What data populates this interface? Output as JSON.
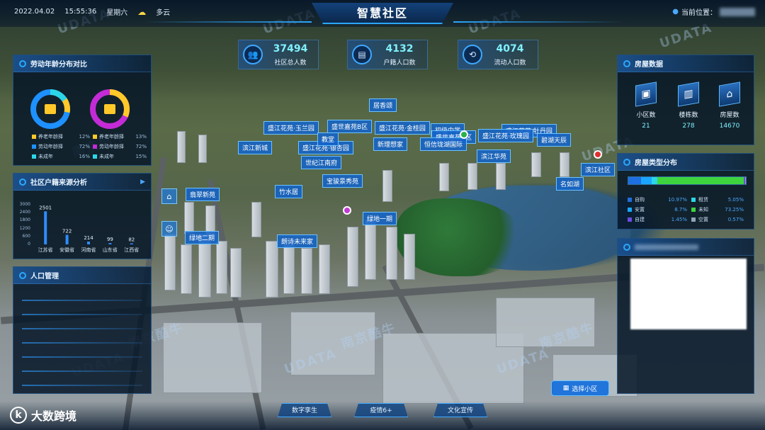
{
  "header": {
    "date": "2022.04.02",
    "time": "15:55:36",
    "weekday": "星期六",
    "weather": "多云",
    "title": "智慧社区",
    "location_label": "当前位置："
  },
  "stats": [
    {
      "value": "37494",
      "label": "社区总人数",
      "icon": "people-icon"
    },
    {
      "value": "4132",
      "label": "户籍人口数",
      "icon": "household-icon"
    },
    {
      "value": "4074",
      "label": "流动人口数",
      "icon": "flow-icon"
    }
  ],
  "age_panel": {
    "title": "劳动年龄分布对比",
    "legend_left": [
      {
        "label": "养老年龄择",
        "pct": "12%",
        "color": "#ffc929"
      },
      {
        "label": "劳动年龄择",
        "pct": "72%",
        "color": "#1e90ff"
      },
      {
        "label": "未成年",
        "pct": "16%",
        "color": "#2cd6e6"
      }
    ],
    "legend_right": [
      {
        "label": "养老年龄择",
        "pct": "13%",
        "color": "#ffc929"
      },
      {
        "label": "劳动年龄择",
        "pct": "72%",
        "color": "#c42bd6"
      },
      {
        "label": "未成年",
        "pct": "15%",
        "color": "#2cd6e6"
      }
    ]
  },
  "chart_data": {
    "type": "bar",
    "title": "社区户籍来源分析",
    "categories": [
      "江苏省",
      "安徽省",
      "河南省",
      "山东省",
      "江西省"
    ],
    "values": [
      2501,
      722,
      214,
      99,
      82
    ],
    "ylim": [
      0,
      3000
    ],
    "yticks": [
      "3000",
      "2400",
      "1800",
      "1200",
      "600",
      "0"
    ],
    "xlabel": "",
    "ylabel": "",
    "color": "#2f8cff"
  },
  "population_panel": {
    "title": "人口管理"
  },
  "housing_panel": {
    "title": "房屋数据",
    "items": [
      {
        "label": "小区数",
        "value": "21",
        "icon": "community-icon"
      },
      {
        "label": "楼栋数",
        "value": "278",
        "icon": "building-icon"
      },
      {
        "label": "房屋数",
        "value": "14670",
        "icon": "house-icon"
      }
    ]
  },
  "house_type_panel": {
    "title": "房屋类型分布",
    "segments": [
      {
        "label": "自购",
        "pct": "10.97%",
        "fraction": 0.1097,
        "color": "#1e6fe0"
      },
      {
        "label": "租赁",
        "pct": "5.05%",
        "fraction": 0.0505,
        "color": "#2cd6e6"
      },
      {
        "label": "安置",
        "pct": "8.7%",
        "fraction": 0.087,
        "color": "#1aa6ff"
      },
      {
        "label": "未知",
        "pct": "73.25%",
        "fraction": 0.7325,
        "color": "#3ed43e"
      },
      {
        "label": "自建",
        "pct": "1.45%",
        "fraction": 0.0145,
        "color": "#6a4de0"
      },
      {
        "label": "空置",
        "pct": "0.57%",
        "fraction": 0.0057,
        "color": "#8fa4b8"
      }
    ]
  },
  "map_labels": [
    "居香颂",
    "盛江花苑·玉兰园",
    "盛世嘉苑B区",
    "盛江花苑·金桂园",
    "初级中学",
    "盛世嘉苑A区",
    "盛江花苑·牡丹园",
    "盛江花苑·玫瑰园",
    "碧湖天辰",
    "滨江新城",
    "盛江花苑·银杏园",
    "新理想家",
    "恒信珑湖国际",
    "滨江华苑",
    "宝骏景秀苑",
    "竹水居",
    "翡翠新苑",
    "绿地一期",
    "绿地二期",
    "朗诗未来家",
    "名如湖",
    "滨江社区",
    "教堂",
    "世纪江南府"
  ],
  "bottom_tabs": [
    "数字孪生",
    "疫情6+",
    "文化宣传"
  ],
  "select_button": "选择小区",
  "brand": {
    "name": "大数跨境",
    "logo": "k"
  },
  "watermarks": [
    "UDATA",
    "南京酷牛"
  ]
}
